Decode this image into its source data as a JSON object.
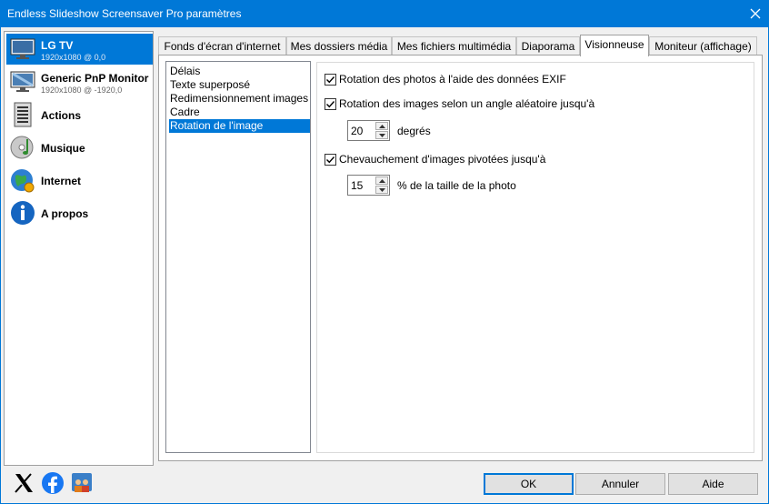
{
  "window": {
    "title": "Endless Slideshow Screensaver Pro paramètres"
  },
  "sidebar": {
    "items": [
      {
        "label": "LG TV",
        "sub": "1920x1080 @ 0,0",
        "icon": "tv-icon",
        "selected": true
      },
      {
        "label": "Generic PnP Monitor",
        "sub": "1920x1080 @ -1920,0",
        "icon": "monitor-icon"
      },
      {
        "label": "Actions",
        "icon": "actions-icon"
      },
      {
        "label": "Musique",
        "icon": "music-icon"
      },
      {
        "label": "Internet",
        "icon": "internet-icon"
      },
      {
        "label": "A propos",
        "icon": "info-icon"
      }
    ]
  },
  "tabs": [
    {
      "label": "Fonds d'écran d'internet"
    },
    {
      "label": "Mes dossiers média"
    },
    {
      "label": "Mes fichiers multimédia"
    },
    {
      "label": "Diaporama"
    },
    {
      "label": "Visionneuse",
      "active": true
    },
    {
      "label": "Moniteur (affichage)"
    }
  ],
  "categories": [
    {
      "label": "Délais"
    },
    {
      "label": "Texte superposé"
    },
    {
      "label": "Redimensionnement images"
    },
    {
      "label": "Cadre"
    },
    {
      "label": "Rotation de l'image",
      "selected": true
    }
  ],
  "settings": {
    "exif": {
      "label": "Rotation des photos à l'aide des données EXIF",
      "checked": true
    },
    "random": {
      "label": "Rotation des images selon un angle aléatoire jusqu'à",
      "checked": true
    },
    "angle": {
      "value": "20",
      "unit": "degrés"
    },
    "overlap": {
      "label": "Chevauchement d'images pivotées jusqu'à",
      "checked": true
    },
    "percent": {
      "value": "15",
      "unit": "% de la taille de la photo"
    }
  },
  "footer": {
    "social": [
      "x-logo-icon",
      "facebook-icon",
      "users-icon"
    ],
    "ok": "OK",
    "cancel": "Annuler",
    "help": "Aide"
  },
  "colors": {
    "accent": "#0078d7",
    "titlebar": "#0078d7"
  }
}
